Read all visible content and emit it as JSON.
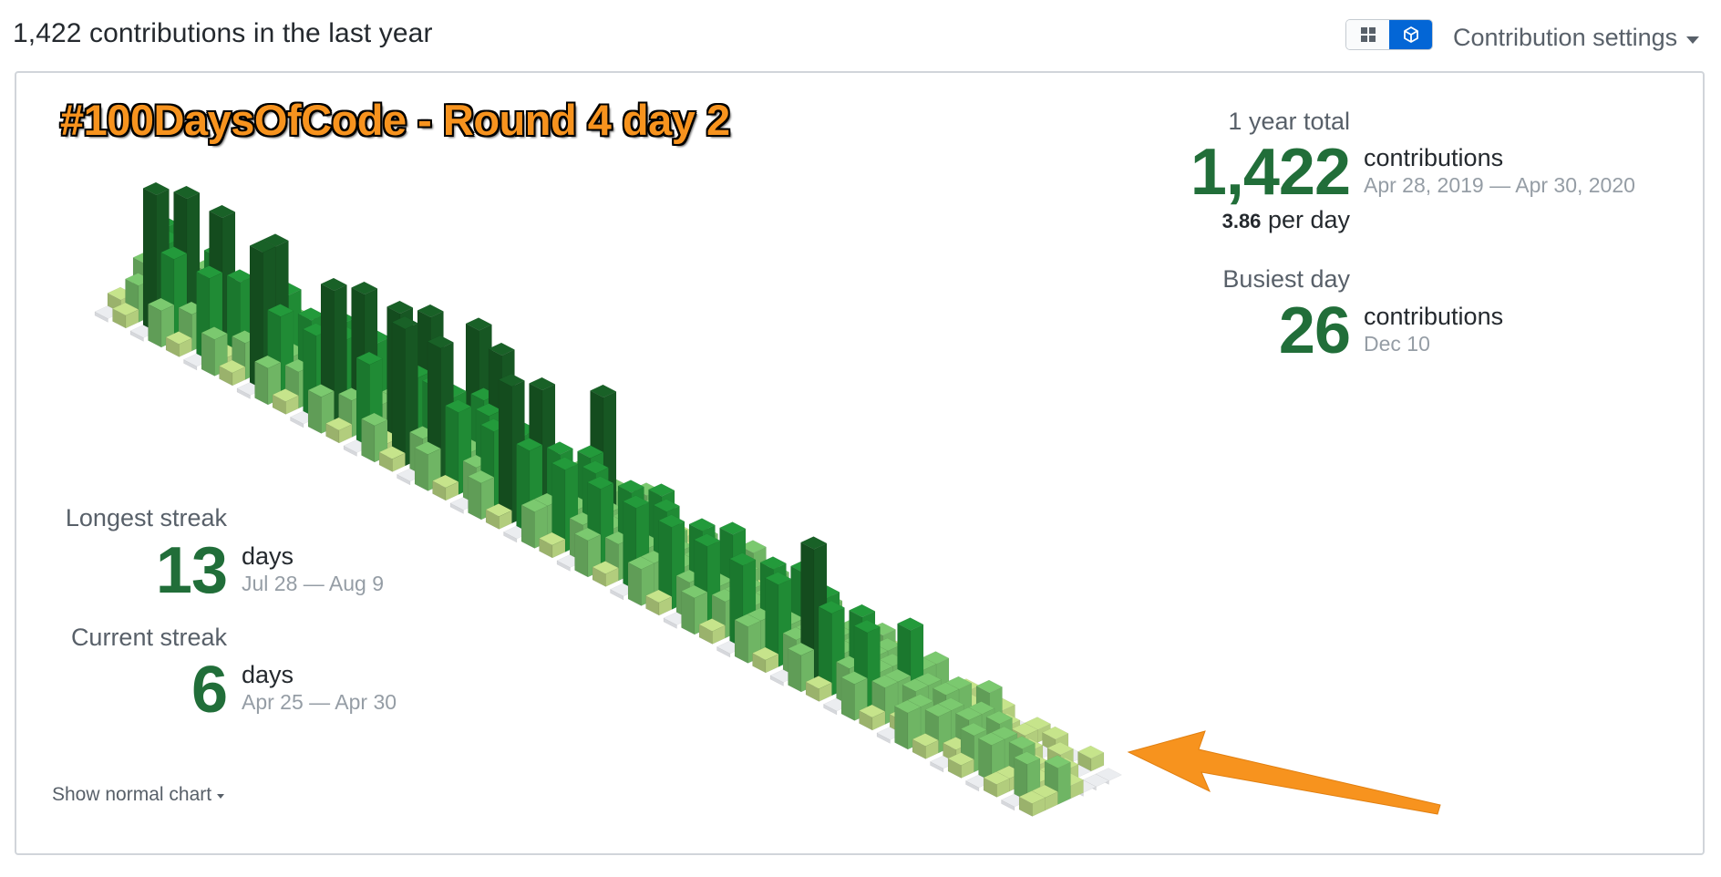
{
  "header": {
    "title": "1,422 contributions in the last year",
    "settings_label": "Contribution settings"
  },
  "view_toggle": {
    "options": [
      "normal-chart",
      "isometric-chart"
    ],
    "selected": "isometric-chart",
    "active_color": "#0366d6"
  },
  "overlay_title": "#100DaysOfCode - Round 4 day 2",
  "stats": {
    "year_total": {
      "label": "1 year total",
      "value": "1,422",
      "unit": "contributions",
      "range": "Apr 28, 2019 — Apr 30, 2020",
      "per_day_value": "3.86",
      "per_day_unit": "per day"
    },
    "busiest_day": {
      "label": "Busiest day",
      "value": "26",
      "unit": "contributions",
      "date": "Dec 10"
    },
    "longest_streak": {
      "label": "Longest streak",
      "value": "13",
      "unit": "days",
      "range": "Jul 28 — Aug 9"
    },
    "current_streak": {
      "label": "Current streak",
      "value": "6",
      "unit": "days",
      "range": "Apr 25 — Apr 30"
    }
  },
  "footer": {
    "show_normal_label": "Show normal chart"
  },
  "colors": {
    "accent_green": "#216e39",
    "arrow": "#f7931e",
    "levels": [
      "#ebedf0",
      "#c6e48b",
      "#7bc96f",
      "#239a3b",
      "#196127"
    ]
  },
  "chart_data": {
    "type": "heatmap",
    "rendering": "isometric-3d",
    "weeks": 53,
    "days_per_week": 7,
    "levels_by_week": [
      [
        0,
        1,
        0,
        2,
        1,
        0,
        1
      ],
      [
        1,
        2,
        1,
        3,
        2,
        1,
        0
      ],
      [
        0,
        4,
        3,
        1,
        0,
        2,
        1
      ],
      [
        2,
        3,
        4,
        2,
        1,
        0,
        1
      ],
      [
        1,
        2,
        0,
        3,
        2,
        1,
        2
      ],
      [
        0,
        3,
        4,
        2,
        1,
        2,
        0
      ],
      [
        2,
        1,
        3,
        2,
        2,
        1,
        1
      ],
      [
        1,
        2,
        0,
        2,
        1,
        2,
        0
      ],
      [
        0,
        4,
        4,
        3,
        2,
        1,
        2
      ],
      [
        2,
        3,
        2,
        1,
        2,
        1,
        0
      ],
      [
        1,
        2,
        3,
        2,
        1,
        2,
        1
      ],
      [
        0,
        3,
        2,
        3,
        2,
        1,
        0
      ],
      [
        2,
        4,
        3,
        2,
        1,
        0,
        1
      ],
      [
        1,
        2,
        4,
        3,
        2,
        1,
        0
      ],
      [
        0,
        3,
        2,
        2,
        1,
        2,
        1
      ],
      [
        2,
        1,
        4,
        3,
        2,
        2,
        0
      ],
      [
        1,
        4,
        3,
        4,
        2,
        1,
        1
      ],
      [
        0,
        2,
        3,
        2,
        1,
        2,
        0
      ],
      [
        2,
        4,
        3,
        2,
        4,
        1,
        1
      ],
      [
        1,
        3,
        2,
        3,
        2,
        1,
        0
      ],
      [
        0,
        2,
        3,
        4,
        2,
        1,
        2
      ],
      [
        2,
        3,
        2,
        2,
        1,
        2,
        0
      ],
      [
        1,
        4,
        3,
        2,
        2,
        1,
        1
      ],
      [
        0,
        3,
        4,
        2,
        1,
        2,
        0
      ],
      [
        2,
        2,
        3,
        2,
        1,
        1,
        1
      ],
      [
        1,
        3,
        2,
        3,
        4,
        2,
        0
      ],
      [
        0,
        2,
        3,
        2,
        1,
        1,
        2
      ],
      [
        2,
        3,
        2,
        2,
        1,
        2,
        0
      ],
      [
        1,
        2,
        3,
        2,
        2,
        1,
        1
      ],
      [
        0,
        3,
        2,
        3,
        2,
        1,
        0
      ],
      [
        2,
        2,
        3,
        2,
        1,
        2,
        1
      ],
      [
        1,
        3,
        2,
        2,
        2,
        1,
        0
      ],
      [
        0,
        2,
        3,
        2,
        1,
        1,
        2
      ],
      [
        2,
        3,
        2,
        3,
        2,
        1,
        0
      ],
      [
        1,
        2,
        2,
        2,
        1,
        2,
        1
      ],
      [
        0,
        3,
        2,
        2,
        2,
        1,
        0
      ],
      [
        2,
        2,
        3,
        2,
        1,
        1,
        1
      ],
      [
        1,
        3,
        2,
        3,
        2,
        2,
        0
      ],
      [
        0,
        2,
        2,
        2,
        1,
        1,
        1
      ],
      [
        2,
        4,
        3,
        2,
        2,
        1,
        0
      ],
      [
        1,
        3,
        2,
        2,
        1,
        2,
        1
      ],
      [
        0,
        2,
        3,
        2,
        2,
        1,
        0
      ],
      [
        2,
        3,
        2,
        2,
        1,
        1,
        1
      ],
      [
        1,
        2,
        2,
        3,
        2,
        2,
        0
      ],
      [
        0,
        1,
        2,
        2,
        1,
        1,
        1
      ],
      [
        2,
        2,
        1,
        2,
        2,
        1,
        0
      ],
      [
        1,
        2,
        2,
        1,
        1,
        2,
        1
      ],
      [
        0,
        1,
        2,
        2,
        1,
        1,
        0
      ],
      [
        1,
        2,
        1,
        2,
        0,
        1,
        1
      ],
      [
        0,
        2,
        2,
        1,
        1,
        0,
        1
      ],
      [
        1,
        1,
        2,
        1,
        0,
        1,
        0
      ],
      [
        0,
        2,
        1,
        1,
        1,
        0,
        1
      ],
      [
        1,
        1,
        2,
        1,
        0,
        0,
        0
      ]
    ]
  }
}
